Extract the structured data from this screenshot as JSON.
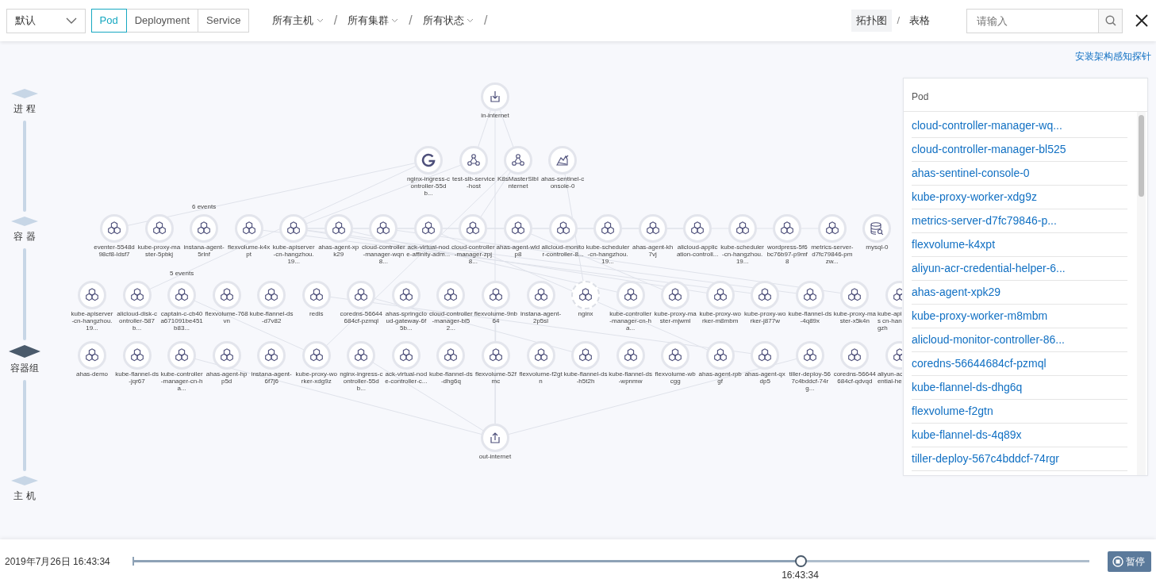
{
  "toolbar": {
    "view_select": {
      "value": "默认"
    },
    "resource_tabs": [
      {
        "label": "Pod",
        "selected": true
      },
      {
        "label": "Deployment",
        "selected": false
      },
      {
        "label": "Service",
        "selected": false
      }
    ],
    "filters": [
      {
        "label": "所有主机"
      },
      {
        "label": "所有集群"
      },
      {
        "label": "所有状态"
      }
    ],
    "filter_separator": "/",
    "view_modes": [
      {
        "label": "拓扑图",
        "selected": true
      },
      {
        "label": "表格",
        "selected": false
      }
    ],
    "view_mode_separator": "/",
    "search": {
      "placeholder": "请输入"
    }
  },
  "probe_link": "安装架构感知探针",
  "levels": [
    {
      "label": "进 程",
      "selected": false
    },
    {
      "label": "容 器",
      "selected": false
    },
    {
      "label": "容器组",
      "selected": true
    },
    {
      "label": "主 机",
      "selected": false
    }
  ],
  "tiers": [
    {
      "nodes": [
        {
          "label": "in-internet",
          "kind": "in"
        }
      ]
    },
    {
      "nodes": [
        {
          "label": "nginx-ingress-controller-55db...",
          "kind": "ingress"
        },
        {
          "label": "test-slb-service-host",
          "kind": "service"
        },
        {
          "label": "K8sMasterSlbInternet",
          "kind": "service"
        },
        {
          "label": "ahas-sentinel-console-0",
          "kind": "sentinel"
        }
      ]
    },
    {
      "nodes": [
        {
          "label": "eventer-5548d98cf8-ldsf7",
          "kind": "pod"
        },
        {
          "label": "kube-proxy-master-5pbkj",
          "kind": "pod"
        },
        {
          "label": "instana-agent-5rlnf",
          "kind": "pod",
          "events": "6 events"
        },
        {
          "label": "flexvolume-k4xpt",
          "kind": "pod"
        },
        {
          "label": "kube-apiserver-cn-hangzhou.19...",
          "kind": "pod"
        },
        {
          "label": "ahas-agent-xpk29",
          "kind": "pod"
        },
        {
          "label": "cloud-controller-manager-wqn8...",
          "kind": "pod"
        },
        {
          "label": "ack-virtual-node-affinity-adm...",
          "kind": "pod"
        },
        {
          "label": "cloud-controller-manager-zpj8...",
          "kind": "pod"
        },
        {
          "label": "ahas-agent-wldp8",
          "kind": "pod"
        },
        {
          "label": "alicloud-monitor-controller-8...",
          "kind": "pod"
        },
        {
          "label": "kube-scheduler-cn-hangzhou.19...",
          "kind": "pod"
        },
        {
          "label": "ahas-agent-kh7vj",
          "kind": "pod"
        },
        {
          "label": "alicloud-application-controll...",
          "kind": "pod"
        },
        {
          "label": "kube-scheduler-cn-hangzhou.19...",
          "kind": "pod"
        },
        {
          "label": "wordpress-5f6bc76b97-p9mf8",
          "kind": "pod"
        },
        {
          "label": "metrics-server-d7fc79846-pmzw...",
          "kind": "pod"
        },
        {
          "label": "mysql-0",
          "kind": "database"
        }
      ]
    },
    {
      "nodes": [
        {
          "label": "kube-apiserver-cn-hangzhou.19...",
          "kind": "pod"
        },
        {
          "label": "alicloud-disk-controller-587b...",
          "kind": "pod"
        },
        {
          "label": "captain-c-cb40a671091be451b83...",
          "kind": "pod",
          "events": "5 events"
        },
        {
          "label": "flexvolume-768vn",
          "kind": "pod"
        },
        {
          "label": "kube-flannel-ds-d7v82",
          "kind": "pod"
        },
        {
          "label": "redis",
          "kind": "pod"
        },
        {
          "label": "coredns-56644684cf-pzmql",
          "kind": "pod"
        },
        {
          "label": "ahas-springcloud-gateway-6f5b...",
          "kind": "pod"
        },
        {
          "label": "cloud-controller-manager-bl52...",
          "kind": "pod"
        },
        {
          "label": "flexvolume-9nb64",
          "kind": "pod"
        },
        {
          "label": "instana-agent-2p5sl",
          "kind": "pod"
        },
        {
          "label": "nginx",
          "kind": "virtual-pod"
        },
        {
          "label": "kube-controller-manager-cn-ha...",
          "kind": "pod"
        },
        {
          "label": "kube-proxy-master-mjwml",
          "kind": "pod"
        },
        {
          "label": "kube-proxy-worker-m8mbm",
          "kind": "pod"
        },
        {
          "label": "kube-proxy-worker-j877w",
          "kind": "pod"
        },
        {
          "label": "kube-flannel-ds-4q89x",
          "kind": "pod"
        },
        {
          "label": "kube-proxy-master-x5k4n",
          "kind": "pod"
        },
        {
          "label": "kube-apis cn-hangzh",
          "kind": "clipped-pod"
        }
      ]
    },
    {
      "nodes": [
        {
          "label": "ahas-demo",
          "kind": "pod"
        },
        {
          "label": "kube-flannel-ds-jqr67",
          "kind": "pod"
        },
        {
          "label": "kube-controller-manager-cn-ha...",
          "kind": "pod"
        },
        {
          "label": "ahas-agent-hpp5d",
          "kind": "pod"
        },
        {
          "label": "instana-agent-6f7j6",
          "kind": "pod"
        },
        {
          "label": "kube-proxy-worker-xdg9z",
          "kind": "pod"
        },
        {
          "label": "nginx-ingress-controller-55db...",
          "kind": "pod"
        },
        {
          "label": "ack-virtual-node-controller-c...",
          "kind": "pod"
        },
        {
          "label": "kube-flannel-ds-dhg6q",
          "kind": "pod"
        },
        {
          "label": "flexvolume-52fmc",
          "kind": "pod"
        },
        {
          "label": "flexvolume-f2gtn",
          "kind": "pod"
        },
        {
          "label": "kube-flannel-ds-h5t2h",
          "kind": "pod"
        },
        {
          "label": "kube-flannel-ds-wpnmw",
          "kind": "pod"
        },
        {
          "label": "flexvolume-wbcgg",
          "kind": "pod"
        },
        {
          "label": "ahas-agent-rpbgf",
          "kind": "pod"
        },
        {
          "label": "ahas-agent-qxdp5",
          "kind": "pod"
        },
        {
          "label": "tiller-deploy-567c4bddcf-74rg...",
          "kind": "pod"
        },
        {
          "label": "coredns-56644684cf-qdvqd",
          "kind": "pod"
        },
        {
          "label": "aliyun-ac ential-hel",
          "kind": "clipped-pod"
        }
      ]
    },
    {
      "nodes": [
        {
          "label": "out-internet",
          "kind": "out"
        }
      ]
    }
  ],
  "pod_panel": {
    "title": "Pod",
    "items": [
      "cloud-controller-manager-wq...",
      "cloud-controller-manager-bl525",
      "ahas-sentinel-console-0",
      "kube-proxy-worker-xdg9z",
      "metrics-server-d7fc79846-p...",
      "flexvolume-k4xpt",
      "aliyun-acr-credential-helper-6...",
      "ahas-agent-xpk29",
      "kube-proxy-worker-m8mbm",
      "alicloud-monitor-controller-86...",
      "coredns-56644684cf-pzmql",
      "kube-flannel-ds-dhg6q",
      "flexvolume-f2gtn",
      "kube-flannel-ds-4q89x",
      "tiller-deploy-567c4bddcf-74rgr"
    ]
  },
  "timeline": {
    "date": "2019年7月26日 16:43:34",
    "level": 0.698,
    "thumb_label": "16:43:34",
    "pause_button": "暂停"
  }
}
